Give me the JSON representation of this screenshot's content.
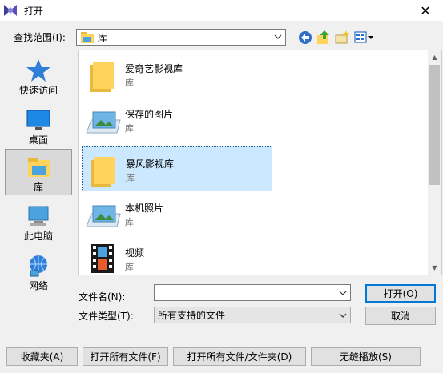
{
  "window": {
    "title": "打开",
    "close_glyph": "✕"
  },
  "lookin": {
    "label": "查找范围(I):",
    "value": "库"
  },
  "places": [
    {
      "label": "快速访问",
      "icon": "star-icon"
    },
    {
      "label": "桌面",
      "icon": "desktop-icon"
    },
    {
      "label": "库",
      "icon": "library-icon"
    },
    {
      "label": "此电脑",
      "icon": "computer-icon"
    },
    {
      "label": "网络",
      "icon": "network-icon"
    }
  ],
  "files": [
    {
      "name": "爱奇艺影视库",
      "type": "库",
      "icon": "folder-icon"
    },
    {
      "name": "保存的图片",
      "type": "库",
      "icon": "pictures-icon"
    },
    {
      "name": "暴风影视库",
      "type": "库",
      "icon": "folder-icon"
    },
    {
      "name": "本机照片",
      "type": "库",
      "icon": "pictures-icon"
    },
    {
      "name": "视频",
      "type": "库",
      "icon": "video-icon"
    }
  ],
  "filename": {
    "label": "文件名(N):",
    "value": ""
  },
  "filetype": {
    "label": "文件类型(T):",
    "value": "所有支持的文件"
  },
  "buttons": {
    "open": "打开(O)",
    "cancel": "取消",
    "favorites": "收藏夹(A)",
    "open_all_files": "打开所有文件(F)",
    "open_all_files_folders": "打开所有文件/文件夹(D)",
    "seamless_play": "无缝播放(S)"
  },
  "colors": {
    "selection": "#cce8ff",
    "accent": "#0078d7",
    "folder": "#ffd35c"
  }
}
